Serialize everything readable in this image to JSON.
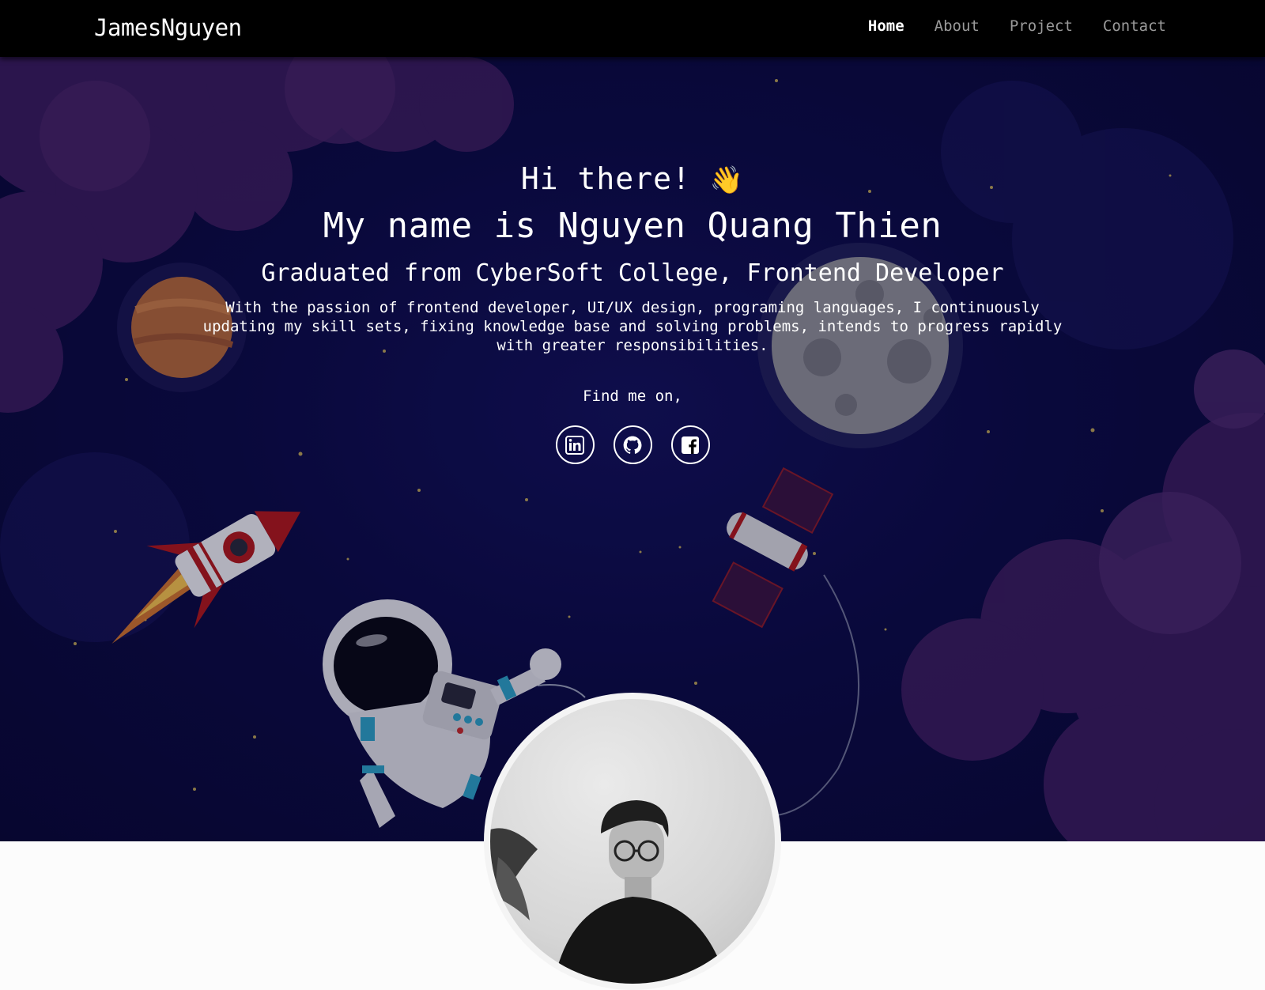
{
  "nav": {
    "brand": "JamesNguyen",
    "links": [
      {
        "label": "Home",
        "active": true
      },
      {
        "label": "About",
        "active": false
      },
      {
        "label": "Project",
        "active": false
      },
      {
        "label": "Contact",
        "active": false
      }
    ]
  },
  "hero": {
    "greeting": "Hi there!",
    "wave_emoji": "👋",
    "name_line": "My name is Nguyen Quang Thien",
    "role_line": "Graduated from CyberSoft College, Frontend Developer",
    "description": "With the passion of frontend developer, UI/UX design, programing languages, I continuously updating my skill sets, fixing knowledge base and solving problems, intends to progress rapidly with greater responsibilities.",
    "find_me": "Find me on,",
    "socials": [
      {
        "icon": "linkedin-icon"
      },
      {
        "icon": "github-icon"
      },
      {
        "icon": "facebook-icon"
      }
    ]
  },
  "colors": {
    "nav_bg": "#000000",
    "hero_bg": "#0d0c45",
    "cloud": "#4a2466",
    "text": "#ffffff"
  }
}
